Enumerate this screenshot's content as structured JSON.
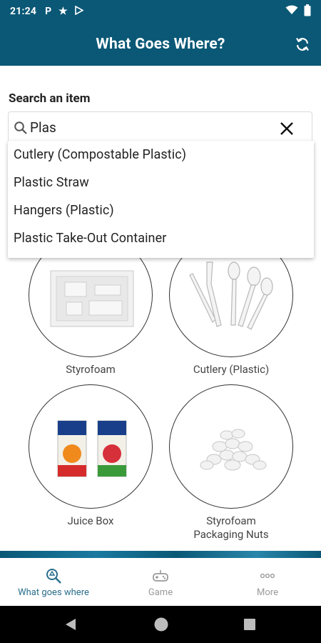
{
  "status_bar": {
    "time": "21:24",
    "left_icons": [
      "parking-icon",
      "star-icon",
      "play-store-icon"
    ],
    "right_icons": [
      "wifi-icon",
      "battery-icon"
    ]
  },
  "app_bar": {
    "title": "What Goes Where?",
    "refresh_icon": "refresh-icon"
  },
  "search": {
    "label": "Search an item",
    "value": "Plas",
    "search_icon": "search-icon",
    "clear_icon": "close-icon"
  },
  "suggestions": [
    "Cutlery (Compostable Plastic)",
    "Plastic Straw",
    "Hangers (Plastic)",
    "Plastic Take-Out Container"
  ],
  "items": [
    {
      "caption": "Styrofoam",
      "image": "styrofoam-tray-image"
    },
    {
      "caption": "Cutlery (Plastic)",
      "image": "plastic-cutlery-image"
    },
    {
      "caption": "Juice Box",
      "image": "juice-boxes-image"
    },
    {
      "caption": "Styrofoam Packaging Nuts",
      "image": "packing-peanuts-image"
    }
  ],
  "bottom_nav": [
    {
      "label": "What goes where",
      "icon": "search-recycle-icon",
      "active": true
    },
    {
      "label": "Game",
      "icon": "gamepad-icon",
      "active": false
    },
    {
      "label": "More",
      "icon": "more-dots-icon",
      "active": false
    }
  ],
  "colors": {
    "brand": "#0a5876",
    "active_nav": "#2a6e8c",
    "inactive_nav": "#9a9a9a"
  }
}
